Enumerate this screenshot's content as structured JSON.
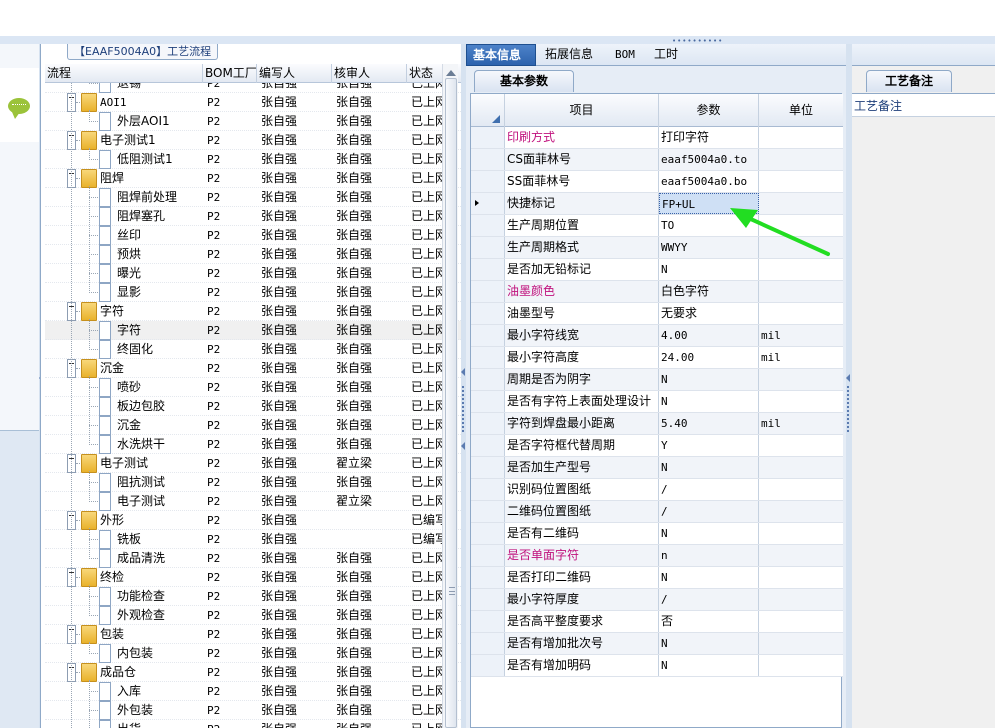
{
  "flow": {
    "title": "【EAAF5004A0】工艺流程",
    "columns": [
      "流程",
      "BOM工厂",
      "编写人",
      "核审人",
      "状态"
    ],
    "rows": [
      {
        "name": "退锡",
        "level": 1,
        "folder": false,
        "bom": "P2",
        "writer": "张自强",
        "reviewer": "张自强",
        "status": "已上网"
      },
      {
        "name": "AOI1",
        "level": 0,
        "folder": true,
        "bom": "P2",
        "writer": "张自强",
        "reviewer": "张自强",
        "status": "已上网"
      },
      {
        "name": "外层AOI1",
        "level": 1,
        "folder": false,
        "bom": "P2",
        "writer": "张自强",
        "reviewer": "张自强",
        "status": "已上网"
      },
      {
        "name": "电子测试1",
        "level": 0,
        "folder": true,
        "bom": "P2",
        "writer": "张自强",
        "reviewer": "张自强",
        "status": "已上网"
      },
      {
        "name": "低阻测试1",
        "level": 1,
        "folder": false,
        "bom": "P2",
        "writer": "张自强",
        "reviewer": "张自强",
        "status": "已上网"
      },
      {
        "name": "阻焊",
        "level": 0,
        "folder": true,
        "bom": "P2",
        "writer": "张自强",
        "reviewer": "张自强",
        "status": "已上网"
      },
      {
        "name": "阻焊前处理",
        "level": 1,
        "folder": false,
        "bom": "P2",
        "writer": "张自强",
        "reviewer": "张自强",
        "status": "已上网"
      },
      {
        "name": "阻焊塞孔",
        "level": 1,
        "folder": false,
        "bom": "P2",
        "writer": "张自强",
        "reviewer": "张自强",
        "status": "已上网"
      },
      {
        "name": "丝印",
        "level": 1,
        "folder": false,
        "bom": "P2",
        "writer": "张自强",
        "reviewer": "张自强",
        "status": "已上网"
      },
      {
        "name": "预烘",
        "level": 1,
        "folder": false,
        "bom": "P2",
        "writer": "张自强",
        "reviewer": "张自强",
        "status": "已上网"
      },
      {
        "name": "曝光",
        "level": 1,
        "folder": false,
        "bom": "P2",
        "writer": "张自强",
        "reviewer": "张自强",
        "status": "已上网"
      },
      {
        "name": "显影",
        "level": 1,
        "folder": false,
        "bom": "P2",
        "writer": "张自强",
        "reviewer": "张自强",
        "status": "已上网"
      },
      {
        "name": "字符",
        "level": 0,
        "folder": true,
        "bom": "P2",
        "writer": "张自强",
        "reviewer": "张自强",
        "status": "已上网"
      },
      {
        "name": "字符",
        "level": 1,
        "folder": false,
        "bom": "P2",
        "writer": "张自强",
        "reviewer": "张自强",
        "status": "已上网",
        "selected": true
      },
      {
        "name": "终固化",
        "level": 1,
        "folder": false,
        "bom": "P2",
        "writer": "张自强",
        "reviewer": "张自强",
        "status": "已上网"
      },
      {
        "name": "沉金",
        "level": 0,
        "folder": true,
        "bom": "P2",
        "writer": "张自强",
        "reviewer": "张自强",
        "status": "已上网"
      },
      {
        "name": "喷砂",
        "level": 1,
        "folder": false,
        "bom": "P2",
        "writer": "张自强",
        "reviewer": "张自强",
        "status": "已上网"
      },
      {
        "name": "板边包胶",
        "level": 1,
        "folder": false,
        "bom": "P2",
        "writer": "张自强",
        "reviewer": "张自强",
        "status": "已上网"
      },
      {
        "name": "沉金",
        "level": 1,
        "folder": false,
        "bom": "P2",
        "writer": "张自强",
        "reviewer": "张自强",
        "status": "已上网"
      },
      {
        "name": "水洗烘干",
        "level": 1,
        "folder": false,
        "bom": "P2",
        "writer": "张自强",
        "reviewer": "张自强",
        "status": "已上网"
      },
      {
        "name": "电子测试",
        "level": 0,
        "folder": true,
        "bom": "P2",
        "writer": "张自强",
        "reviewer": "翟立梁",
        "status": "已上网"
      },
      {
        "name": "阻抗测试",
        "level": 1,
        "folder": false,
        "bom": "P2",
        "writer": "张自强",
        "reviewer": "张自强",
        "status": "已上网"
      },
      {
        "name": "电子测试",
        "level": 1,
        "folder": false,
        "bom": "P2",
        "writer": "张自强",
        "reviewer": "翟立梁",
        "status": "已上网"
      },
      {
        "name": "外形",
        "level": 0,
        "folder": true,
        "bom": "P2",
        "writer": "张自强",
        "reviewer": "",
        "status": "已编写"
      },
      {
        "name": "铣板",
        "level": 1,
        "folder": false,
        "bom": "P2",
        "writer": "张自强",
        "reviewer": "",
        "status": "已编写"
      },
      {
        "name": "成品清洗",
        "level": 1,
        "folder": false,
        "bom": "P2",
        "writer": "张自强",
        "reviewer": "张自强",
        "status": "已上网"
      },
      {
        "name": "终检",
        "level": 0,
        "folder": true,
        "bom": "P2",
        "writer": "张自强",
        "reviewer": "张自强",
        "status": "已上网"
      },
      {
        "name": "功能检查",
        "level": 1,
        "folder": false,
        "bom": "P2",
        "writer": "张自强",
        "reviewer": "张自强",
        "status": "已上网"
      },
      {
        "name": "外观检查",
        "level": 1,
        "folder": false,
        "bom": "P2",
        "writer": "张自强",
        "reviewer": "张自强",
        "status": "已上网"
      },
      {
        "name": "包装",
        "level": 0,
        "folder": true,
        "bom": "P2",
        "writer": "张自强",
        "reviewer": "张自强",
        "status": "已上网"
      },
      {
        "name": "内包装",
        "level": 1,
        "folder": false,
        "bom": "P2",
        "writer": "张自强",
        "reviewer": "张自强",
        "status": "已上网"
      },
      {
        "name": "成品仓",
        "level": 0,
        "folder": true,
        "bom": "P2",
        "writer": "张自强",
        "reviewer": "张自强",
        "status": "已上网"
      },
      {
        "name": "入库",
        "level": 1,
        "folder": false,
        "bom": "P2",
        "writer": "张自强",
        "reviewer": "张自强",
        "status": "已上网"
      },
      {
        "name": "外包装",
        "level": 1,
        "folder": false,
        "bom": "P2",
        "writer": "张自强",
        "reviewer": "张自强",
        "status": "已上网"
      },
      {
        "name": "出货",
        "level": 1,
        "folder": false,
        "bom": "P2",
        "writer": "张自强",
        "reviewer": "张自强",
        "status": "已上网"
      }
    ]
  },
  "tabs": [
    {
      "label": "基本信息",
      "active": true
    },
    {
      "label": "拓展信息",
      "active": false
    },
    {
      "label": "BOM",
      "active": false
    },
    {
      "label": "工时",
      "active": false
    }
  ],
  "params": {
    "title": "基本参数",
    "columns": [
      "项目",
      "参数",
      "单位"
    ],
    "rows": [
      {
        "item": "印刷方式",
        "value": "打印字符",
        "unit": "",
        "highlight": true
      },
      {
        "item": "CS面菲林号",
        "value": "eaaf5004a0.to",
        "unit": ""
      },
      {
        "item": "SS面菲林号",
        "value": "eaaf5004a0.bo",
        "unit": ""
      },
      {
        "item": "快捷标记",
        "value": "FP+UL",
        "unit": "",
        "current": true
      },
      {
        "item": "生产周期位置",
        "value": "TO",
        "unit": ""
      },
      {
        "item": "生产周期格式",
        "value": "WWYY",
        "unit": ""
      },
      {
        "item": "是否加无铅标记",
        "value": "N",
        "unit": ""
      },
      {
        "item": "油墨颜色",
        "value": "白色字符",
        "unit": "",
        "highlight": true
      },
      {
        "item": "油墨型号",
        "value": "无要求",
        "unit": ""
      },
      {
        "item": "最小字符线宽",
        "value": "4.00",
        "unit": "mil"
      },
      {
        "item": "最小字符高度",
        "value": "24.00",
        "unit": "mil"
      },
      {
        "item": "周期是否为阴字",
        "value": "N",
        "unit": ""
      },
      {
        "item": "是否有字符上表面处理设计",
        "value": "N",
        "unit": ""
      },
      {
        "item": "字符到焊盘最小距离",
        "value": "5.40",
        "unit": "mil"
      },
      {
        "item": "是否字符框代替周期",
        "value": "Y",
        "unit": ""
      },
      {
        "item": "是否加生产型号",
        "value": "N",
        "unit": ""
      },
      {
        "item": "识别码位置图纸",
        "value": "/",
        "unit": ""
      },
      {
        "item": "二维码位置图纸",
        "value": "/",
        "unit": ""
      },
      {
        "item": "是否有二维码",
        "value": "N",
        "unit": ""
      },
      {
        "item": "是否单面字符",
        "value": "n",
        "unit": "",
        "highlight": true
      },
      {
        "item": "是否打印二维码",
        "value": "N",
        "unit": ""
      },
      {
        "item": "最小字符厚度",
        "value": "/",
        "unit": ""
      },
      {
        "item": "是否高平整度要求",
        "value": "否",
        "unit": ""
      },
      {
        "item": "是否有增加批次号",
        "value": "N",
        "unit": ""
      },
      {
        "item": "是否有增加明码",
        "value": "N",
        "unit": ""
      }
    ]
  },
  "notes": {
    "tab": "工艺备注",
    "header": "工艺备注"
  },
  "icons": {
    "chat": "chat-bubble-icon",
    "folder": "folder-icon",
    "document": "document-icon",
    "annotation": "green-arrow-annotation"
  },
  "colors": {
    "active_tab": "#2d63ad",
    "highlight_text": "#c0117d",
    "annotation_arrow": "#22dd22",
    "current_cell": "#cfe0f5"
  }
}
